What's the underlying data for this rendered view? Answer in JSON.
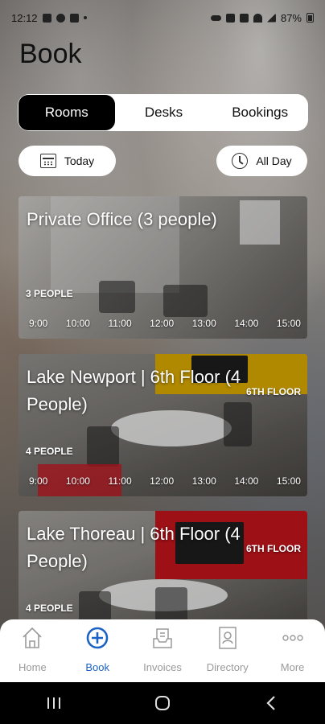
{
  "status_bar": {
    "time": "12:12",
    "battery": "87%"
  },
  "page_title": "Book",
  "tabs": [
    {
      "label": "Rooms",
      "active": true
    },
    {
      "label": "Desks",
      "active": false
    },
    {
      "label": "Bookings",
      "active": false
    }
  ],
  "filters": {
    "date_label": "Today",
    "time_label": "All Day"
  },
  "rooms": [
    {
      "name": "Private Office (3 people)",
      "floor": "",
      "capacity": "3 PEOPLE",
      "times": [
        "9:00",
        "10:00",
        "11:00",
        "12:00",
        "13:00",
        "14:00",
        "15:00"
      ]
    },
    {
      "name": "Lake Newport | 6th Floor (4 People)",
      "floor": "6TH FLOOR",
      "capacity": "4 PEOPLE",
      "times": [
        "9:00",
        "10:00",
        "11:00",
        "12:00",
        "13:00",
        "14:00",
        "15:00"
      ],
      "booked_color": "#c0141c"
    },
    {
      "name": "Lake Thoreau | 6th Floor (4 People)",
      "floor": "6TH FLOOR",
      "capacity": "4 PEOPLE",
      "times": []
    }
  ],
  "bottom_nav": [
    {
      "label": "Home",
      "icon": "home-icon",
      "active": false
    },
    {
      "label": "Book",
      "icon": "plus-circle-icon",
      "active": true
    },
    {
      "label": "Invoices",
      "icon": "invoice-icon",
      "active": false
    },
    {
      "label": "Directory",
      "icon": "contact-book-icon",
      "active": false
    },
    {
      "label": "More",
      "icon": "more-dots-icon",
      "active": false
    }
  ],
  "colors": {
    "accent": "#1c62c4",
    "active_tab": "#000000",
    "booked": "#c0141c"
  }
}
